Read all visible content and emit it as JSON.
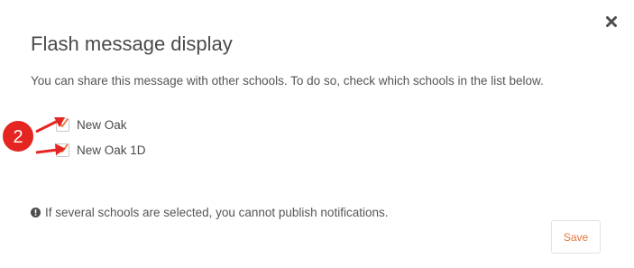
{
  "dialog": {
    "title": "Flash message display",
    "description": "You can share this message with other schools. To do so, check which schools in the list below.",
    "close_icon": "close-icon"
  },
  "schools": [
    {
      "label": "New Oak",
      "checked": true
    },
    {
      "label": "New Oak 1D",
      "checked": true
    }
  ],
  "annotation": {
    "step_number": "2",
    "color": "#e52521"
  },
  "info": {
    "icon": "exclamation-circle-icon",
    "text": "If several schools are selected, you cannot publish notifications."
  },
  "actions": {
    "save_label": "Save"
  },
  "colors": {
    "accent": "#e8743b",
    "annotation": "#e52521"
  }
}
